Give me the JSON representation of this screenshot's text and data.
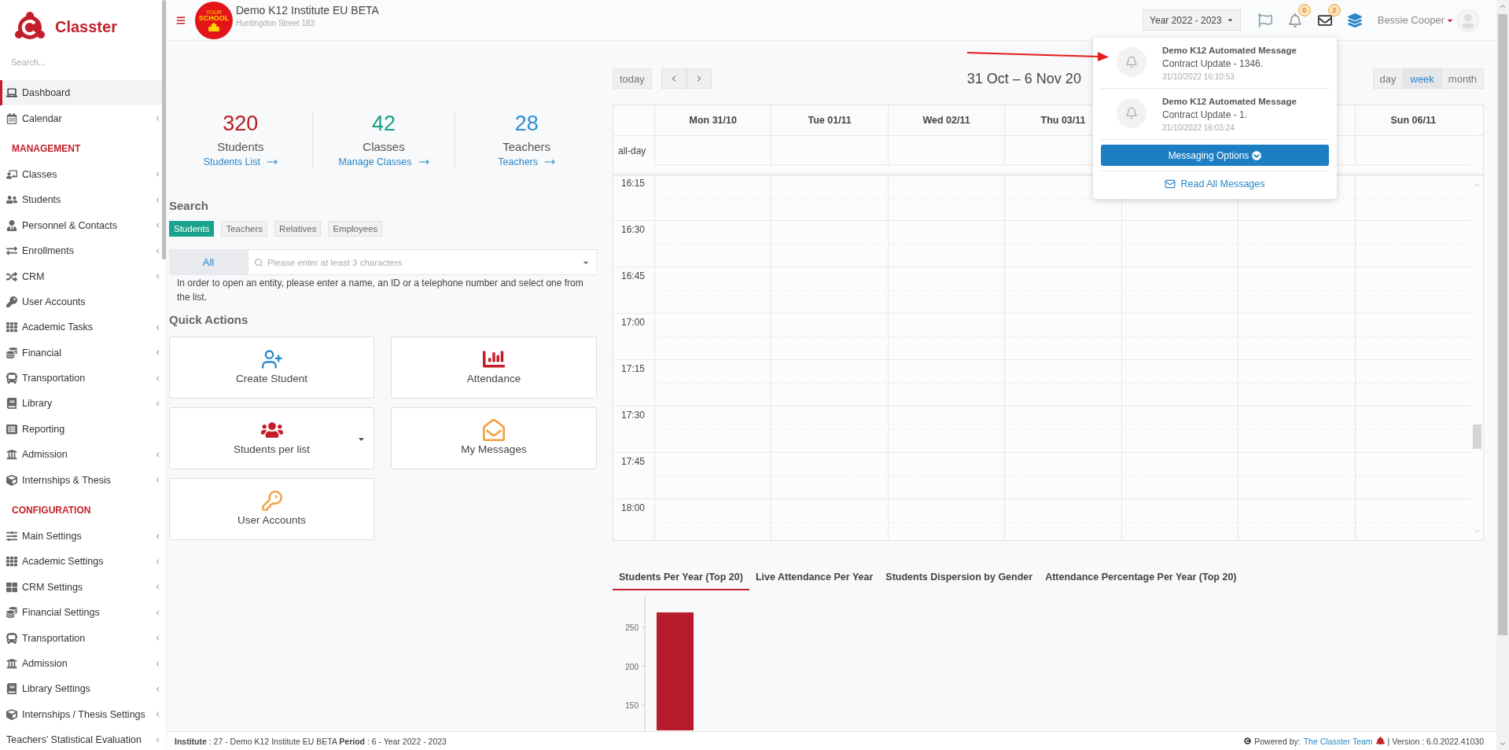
{
  "sidebar": {
    "brand": "Classter",
    "search": {
      "placeholder": "Search..."
    },
    "sections": [
      {
        "items": [
          {
            "label": "Dashboard",
            "selected": true,
            "has_submenu": false
          },
          {
            "label": "Calendar",
            "selected": false,
            "has_submenu": true
          }
        ]
      },
      {
        "title": "MANAGEMENT",
        "items": [
          {
            "label": "Classes",
            "selected": false,
            "has_submenu": true
          },
          {
            "label": "Students",
            "selected": false,
            "has_submenu": true
          },
          {
            "label": "Personnel & Contacts",
            "selected": false,
            "has_submenu": true
          },
          {
            "label": "Enrollments",
            "selected": false,
            "has_submenu": true
          },
          {
            "label": "CRM",
            "selected": false,
            "has_submenu": true
          },
          {
            "label": "User Accounts",
            "selected": false,
            "has_submenu": false
          },
          {
            "label": "Academic Tasks",
            "selected": false,
            "has_submenu": true
          },
          {
            "label": "Financial",
            "selected": false,
            "has_submenu": true
          },
          {
            "label": "Transportation",
            "selected": false,
            "has_submenu": true
          },
          {
            "label": "Library",
            "selected": false,
            "has_submenu": true
          },
          {
            "label": "Reporting",
            "selected": false,
            "has_submenu": false
          },
          {
            "label": "Admission",
            "selected": false,
            "has_submenu": true
          },
          {
            "label": "Internships & Thesis",
            "selected": false,
            "has_submenu": true
          }
        ]
      },
      {
        "title": "CONFIGURATION",
        "items": [
          {
            "label": "Main Settings",
            "selected": false,
            "has_submenu": true
          },
          {
            "label": "Academic Settings",
            "selected": false,
            "has_submenu": true
          },
          {
            "label": "CRM Settings",
            "selected": false,
            "has_submenu": true
          },
          {
            "label": "Financial Settings",
            "selected": false,
            "has_submenu": true
          },
          {
            "label": "Transportation",
            "selected": false,
            "has_submenu": true
          },
          {
            "label": "Admission",
            "selected": false,
            "has_submenu": true
          },
          {
            "label": "Library Settings",
            "selected": false,
            "has_submenu": true
          },
          {
            "label": "Internships / Thesis Settings",
            "selected": false,
            "has_submenu": true
          },
          {
            "label": "Teachers' Statistical Evaluation",
            "selected": false,
            "has_submenu": true
          }
        ]
      }
    ]
  },
  "header": {
    "logo_text": [
      "YOUR",
      "SCHOOL"
    ],
    "institute": "Demo K12 Institute EU BETA",
    "address": "Huntingdon Street 183",
    "year_select": "Year 2022 - 2023",
    "notifications_count": "0",
    "messages_count": "2",
    "user": "Bessie Cooper"
  },
  "notifications": {
    "messages": [
      {
        "title": "Demo K12 Automated Message",
        "body": "Contract Update - 1346.",
        "time": "31/10/2022 16:10:53"
      },
      {
        "title": "Demo K12 Automated Message",
        "body": "Contract Update - 1.",
        "time": "31/10/2022 16:03:24"
      }
    ],
    "options_button": "Messaging Options",
    "read_all": "Read All Messages"
  },
  "stats": [
    {
      "value": "320",
      "label": "Students",
      "link": "Students List",
      "color": "#b71c24"
    },
    {
      "value": "42",
      "label": "Classes",
      "link": "Manage Classes",
      "color": "#1a9e86"
    },
    {
      "value": "28",
      "label": "Teachers",
      "link": "Teachers",
      "color": "#2a8fd4"
    }
  ],
  "search": {
    "title": "Search",
    "tabs": [
      {
        "label": "Students",
        "selected": true
      },
      {
        "label": "Teachers",
        "selected": false
      },
      {
        "label": "Relatives",
        "selected": false
      },
      {
        "label": "Employees",
        "selected": false
      }
    ],
    "scope": "All",
    "placeholder": "Please enter at least 3 characters",
    "help": "In order to open an entity, please enter a name, an ID or a telephone number and select one from the list."
  },
  "quick_actions": {
    "title": "Quick Actions",
    "items": [
      {
        "label": "Create Student",
        "has_dropdown": false
      },
      {
        "label": "Attendance",
        "has_dropdown": false
      },
      {
        "label": "Students per list",
        "has_dropdown": true
      },
      {
        "label": "My Messages",
        "has_dropdown": false
      },
      {
        "label": "User Accounts",
        "has_dropdown": false
      }
    ]
  },
  "calendar": {
    "today_button": "today",
    "title": "31 Oct – 6 Nov 20",
    "views": [
      {
        "label": "day",
        "selected": false
      },
      {
        "label": "week",
        "selected": true
      },
      {
        "label": "month",
        "selected": false
      }
    ],
    "all_day_label": "all-day",
    "days": [
      "Mon 31/10",
      "Tue 01/11",
      "Wed 02/11",
      "Thu 03/11",
      "Sun 06/11"
    ],
    "times": [
      "16:15",
      "16:30",
      "16:45",
      "17:00",
      "17:15",
      "17:30",
      "17:45",
      "18:00"
    ]
  },
  "chart_tabs": [
    {
      "label": "Students Per Year (Top 20)",
      "selected": true
    },
    {
      "label": "Live Attendance Per Year",
      "selected": false
    },
    {
      "label": "Students Dispersion by Gender",
      "selected": false
    },
    {
      "label": "Attendance Percentage Per Year (Top 20)",
      "selected": false
    }
  ],
  "chart": {
    "axis_labels": [
      "250",
      "200",
      "150"
    ]
  },
  "footer": {
    "info": "**Institute** : 27 - Demo K12 Institute EU BETA **Period** : 6 - Year 2022 - 2023",
    "powered_by": "Powered by:",
    "team_link": "The Classter Team",
    "version": "| Version : 6.0.2022.41030"
  }
}
